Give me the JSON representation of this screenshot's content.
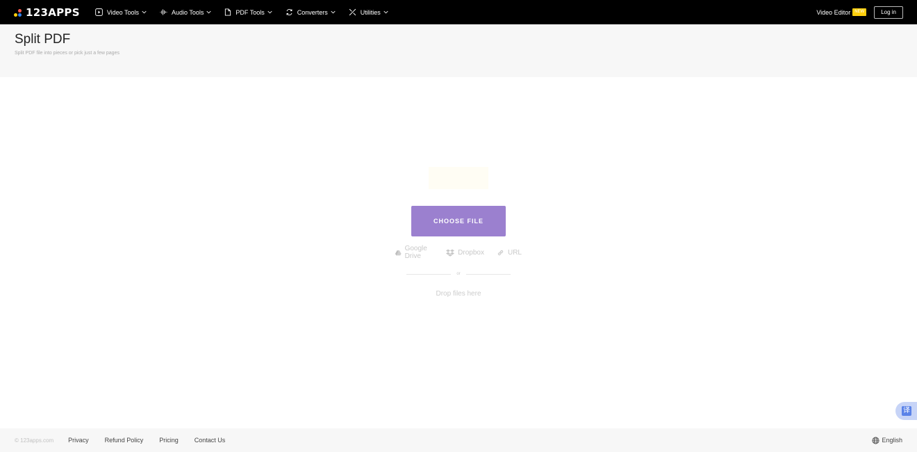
{
  "brand": {
    "name": "123APPS",
    "dot_colors": [
      "#ffcf0d",
      "#2f80ed",
      "#ff5a4e"
    ]
  },
  "nav": {
    "items": [
      {
        "label": "Video Tools",
        "icon": "play-square-icon"
      },
      {
        "label": "Audio Tools",
        "icon": "waveform-icon"
      },
      {
        "label": "PDF Tools",
        "icon": "document-icon"
      },
      {
        "label": "Converters",
        "icon": "convert-icon"
      },
      {
        "label": "Utilities",
        "icon": "tools-icon"
      }
    ],
    "video_editor_label": "Video Editor",
    "new_badge": "NEW",
    "login_label": "Log in"
  },
  "page": {
    "title": "Split PDF",
    "subtitle": "Split PDF file into pieces or pick just a few pages"
  },
  "uploader": {
    "choose_label": "CHOOSE FILE",
    "button_color": "#9b80cf",
    "sources": [
      {
        "label": "Google Drive",
        "icon": "google-drive-icon"
      },
      {
        "label": "Dropbox",
        "icon": "dropbox-icon"
      },
      {
        "label": "URL",
        "icon": "link-icon"
      }
    ],
    "or_label": "or",
    "drop_label": "Drop files here"
  },
  "translate": {
    "glyph": "译"
  },
  "footer": {
    "copyright": "© 123apps.com",
    "links": [
      "Privacy",
      "Refund Policy",
      "Pricing",
      "Contact Us"
    ],
    "language": "English"
  }
}
